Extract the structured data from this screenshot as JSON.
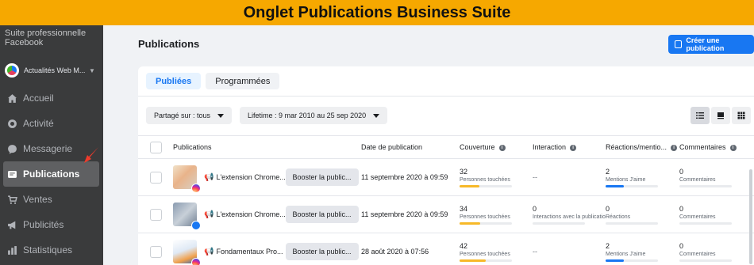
{
  "banner": {
    "title": "Onglet Publications Business Suite"
  },
  "sidebar": {
    "brand": "Suite professionnelle Facebook",
    "account_name": "Actualités Web M...",
    "items": [
      {
        "label": "Accueil",
        "icon": "home-icon",
        "active": false
      },
      {
        "label": "Activité",
        "icon": "activity-icon",
        "active": false
      },
      {
        "label": "Messagerie",
        "icon": "chat-icon",
        "active": false
      },
      {
        "label": "Publications",
        "icon": "posts-icon",
        "active": true
      },
      {
        "label": "Ventes",
        "icon": "cart-icon",
        "active": false
      },
      {
        "label": "Publicités",
        "icon": "megaphone-icon",
        "active": false
      },
      {
        "label": "Statistiques",
        "icon": "chart-icon",
        "active": false
      }
    ]
  },
  "header": {
    "title": "Publications",
    "create_label": "Créer une publication"
  },
  "tabs": [
    {
      "label": "Publiées",
      "active": true
    },
    {
      "label": "Programmées",
      "active": false
    }
  ],
  "filters": {
    "share": "Partagé sur : tous",
    "range": "Lifetime : 9 mar 2010 au 25 sep 2020"
  },
  "table": {
    "columns": {
      "publications": "Publications",
      "date": "Date de publication",
      "coverage": "Couverture",
      "interaction": "Interaction",
      "reactions": "Réactions/mentio...",
      "comments": "Commentaires"
    },
    "rows": [
      {
        "title": "L'extension Chrome...",
        "platform": "instagram",
        "boost": "Booster la public...",
        "date": "11 septembre 2020 à 09:59",
        "coverage": {
          "value": "32",
          "label": "Personnes touchées",
          "fill": 0.38
        },
        "interaction": {
          "value": "--",
          "label": ""
        },
        "reactions": {
          "value": "2",
          "label": "Mentions J'aime",
          "fill": 0.35
        },
        "comments": {
          "value": "0",
          "label": "Commentaires"
        }
      },
      {
        "title": "L'extension Chrome...",
        "platform": "facebook",
        "boost": "Booster la public...",
        "date": "11 septembre 2020 à 09:59",
        "coverage": {
          "value": "34",
          "label": "Personnes touchées",
          "fill": 0.4
        },
        "interaction": {
          "value": "0",
          "label": "Interactions avec la publication"
        },
        "reactions": {
          "value": "0",
          "label": "Réactions",
          "fill": 0
        },
        "comments": {
          "value": "0",
          "label": "Commentaires"
        }
      },
      {
        "title": "Fondamentaux Pro...",
        "platform": "instagram",
        "boost": "Booster la public...",
        "date": "28 août 2020 à 07:56",
        "coverage": {
          "value": "42",
          "label": "Personnes touchées",
          "fill": 0.5
        },
        "interaction": {
          "value": "--",
          "label": ""
        },
        "reactions": {
          "value": "2",
          "label": "Mentions J'aime",
          "fill": 0.35
        },
        "comments": {
          "value": "0",
          "label": "Commentaires"
        }
      }
    ]
  },
  "colors": {
    "accent": "#1877f2",
    "banner": "#f6a800",
    "coverage_bar": "#f7b928"
  }
}
